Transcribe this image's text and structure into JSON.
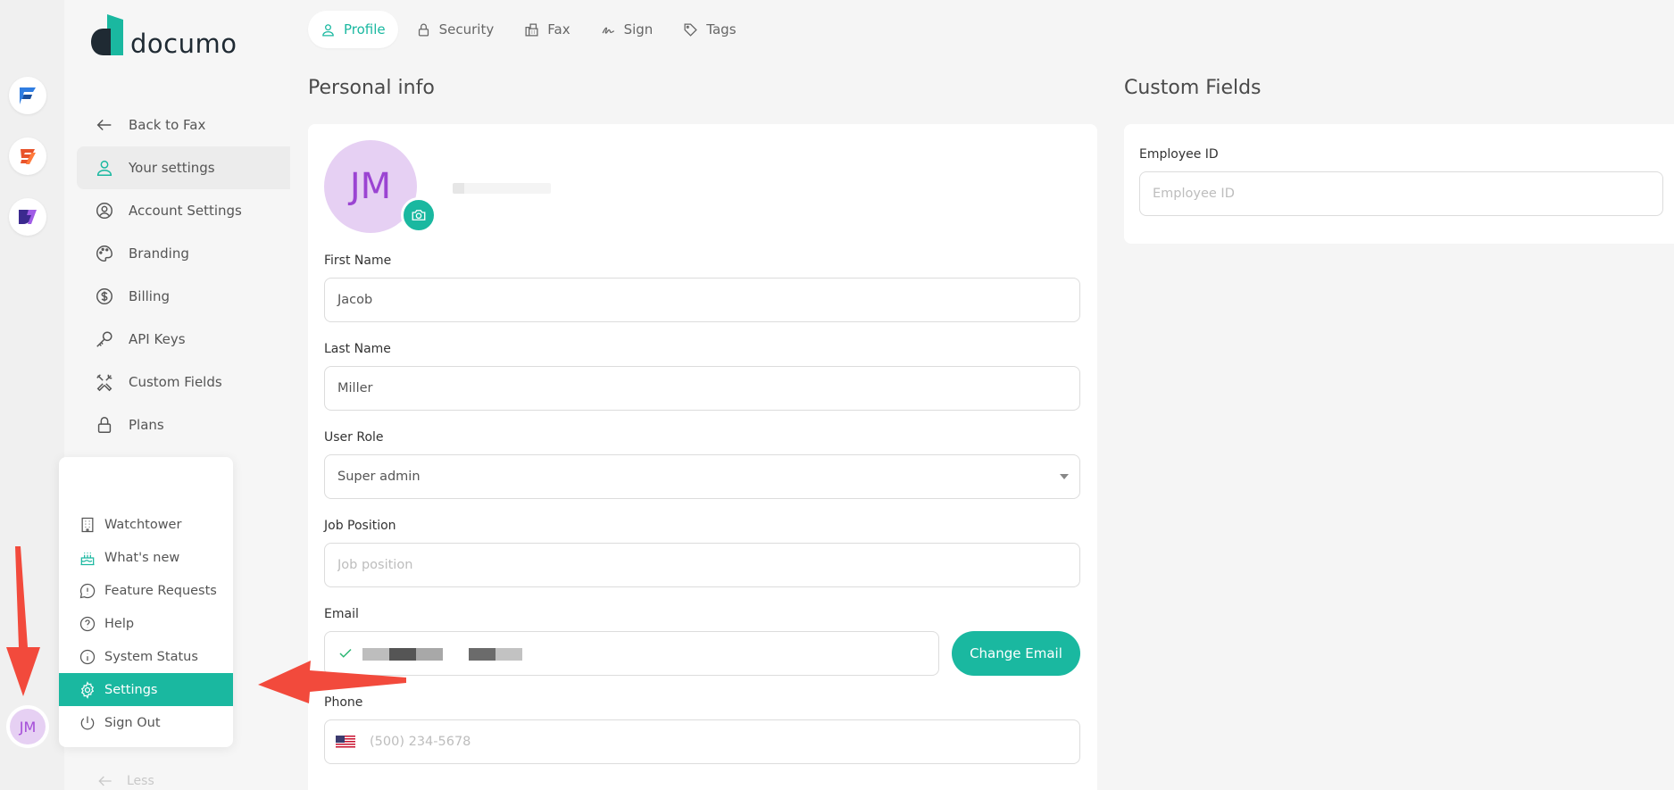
{
  "app": {
    "brand": "documo",
    "brand_color": "#1ab8a0",
    "user_initials": "JM"
  },
  "rail": {
    "apps": [
      {
        "name": "fax-app-icon",
        "color": "#2f7de1"
      },
      {
        "name": "sign-app-icon",
        "color": "#e8532b"
      },
      {
        "name": "docs-app-icon",
        "color": "#7a3fd1"
      }
    ]
  },
  "sidebar": {
    "items": [
      {
        "label": "Back to Fax",
        "icon": "arrow-left-icon"
      },
      {
        "label": "Your settings",
        "icon": "user-icon"
      },
      {
        "label": "Account Settings",
        "icon": "user-circle-icon"
      },
      {
        "label": "Branding",
        "icon": "palette-icon"
      },
      {
        "label": "Billing",
        "icon": "dollar-icon"
      },
      {
        "label": "API Keys",
        "icon": "key-icon"
      },
      {
        "label": "Custom Fields",
        "icon": "tools-icon"
      },
      {
        "label": "Plans",
        "icon": "lock-icon"
      }
    ],
    "less_label": "Less"
  },
  "popup": {
    "items": [
      {
        "label": "Watchtower",
        "icon": "building-icon"
      },
      {
        "label": "What's new",
        "icon": "cake-icon"
      },
      {
        "label": "Feature Requests",
        "icon": "message-alert-icon"
      },
      {
        "label": "Help",
        "icon": "help-icon"
      },
      {
        "label": "System Status",
        "icon": "info-icon"
      },
      {
        "label": "Settings",
        "icon": "gear-icon"
      },
      {
        "label": "Sign Out",
        "icon": "power-icon"
      }
    ]
  },
  "tabs": [
    {
      "label": "Profile",
      "icon": "user-icon"
    },
    {
      "label": "Security",
      "icon": "lock-icon"
    },
    {
      "label": "Fax",
      "icon": "fax-icon"
    },
    {
      "label": "Sign",
      "icon": "signature-icon"
    },
    {
      "label": "Tags",
      "icon": "tag-icon"
    }
  ],
  "personal": {
    "title": "Personal info",
    "avatar_initials": "JM",
    "first_name_label": "First Name",
    "first_name": "Jacob",
    "last_name_label": "Last Name",
    "last_name": "Miller",
    "role_label": "User Role",
    "role": "Super admin",
    "job_label": "Job Position",
    "job_placeholder": "Job position",
    "email_label": "Email",
    "change_email": "Change Email",
    "phone_label": "Phone",
    "phone_placeholder": "(500) 234-5678"
  },
  "custom": {
    "title": "Custom Fields",
    "employee_label": "Employee ID",
    "employee_placeholder": "Employee ID"
  }
}
